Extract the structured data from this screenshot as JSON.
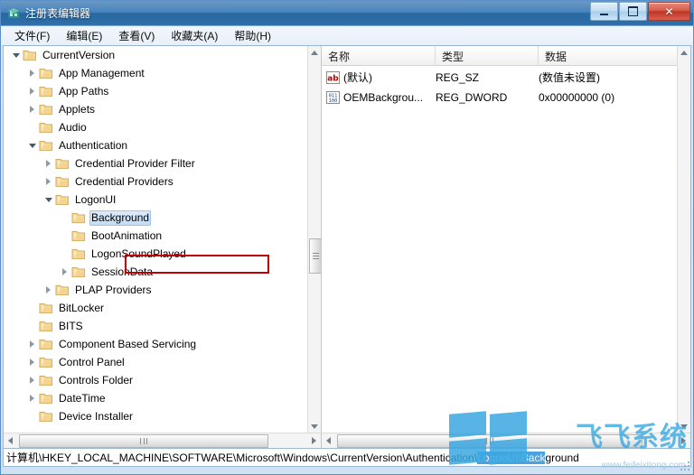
{
  "window": {
    "title": "注册表编辑器",
    "icon": "registry-editor-icon",
    "buttons": {
      "minimize": "最小化",
      "maximize": "最大化",
      "close": "✕"
    }
  },
  "menu": {
    "items": [
      {
        "label": "文件(F)",
        "name": "menu-file"
      },
      {
        "label": "编辑(E)",
        "name": "menu-edit"
      },
      {
        "label": "查看(V)",
        "name": "menu-view"
      },
      {
        "label": "收藏夹(A)",
        "name": "menu-favorites"
      },
      {
        "label": "帮助(H)",
        "name": "menu-help"
      }
    ]
  },
  "tree": {
    "nodes": [
      {
        "label": "CurrentVersion",
        "depth": 0,
        "state": "expanded",
        "selected": false
      },
      {
        "label": "App Management",
        "depth": 1,
        "state": "collapsed",
        "selected": false
      },
      {
        "label": "App Paths",
        "depth": 1,
        "state": "collapsed",
        "selected": false
      },
      {
        "label": "Applets",
        "depth": 1,
        "state": "collapsed",
        "selected": false
      },
      {
        "label": "Audio",
        "depth": 1,
        "state": "leaf",
        "selected": false
      },
      {
        "label": "Authentication",
        "depth": 1,
        "state": "expanded",
        "selected": false
      },
      {
        "label": "Credential Provider Filter",
        "depth": 2,
        "state": "collapsed",
        "selected": false
      },
      {
        "label": "Credential Providers",
        "depth": 2,
        "state": "collapsed",
        "selected": false
      },
      {
        "label": "LogonUI",
        "depth": 2,
        "state": "expanded",
        "selected": false
      },
      {
        "label": "Background",
        "depth": 3,
        "state": "leaf",
        "selected": true
      },
      {
        "label": "BootAnimation",
        "depth": 3,
        "state": "leaf",
        "selected": false
      },
      {
        "label": "LogonSoundPlayed",
        "depth": 3,
        "state": "leaf",
        "selected": false
      },
      {
        "label": "SessionData",
        "depth": 3,
        "state": "collapsed",
        "selected": false
      },
      {
        "label": "PLAP Providers",
        "depth": 2,
        "state": "collapsed",
        "selected": false
      },
      {
        "label": "BitLocker",
        "depth": 1,
        "state": "leaf",
        "selected": false
      },
      {
        "label": "BITS",
        "depth": 1,
        "state": "leaf",
        "selected": false
      },
      {
        "label": "Component Based Servicing",
        "depth": 1,
        "state": "collapsed",
        "selected": false
      },
      {
        "label": "Control Panel",
        "depth": 1,
        "state": "collapsed",
        "selected": false
      },
      {
        "label": "Controls Folder",
        "depth": 1,
        "state": "collapsed",
        "selected": false
      },
      {
        "label": "DateTime",
        "depth": 1,
        "state": "collapsed",
        "selected": false
      },
      {
        "label": "Device Installer",
        "depth": 1,
        "state": "leaf",
        "selected": false
      }
    ],
    "highlight_node": "Background",
    "highlight_color": "#c00000"
  },
  "values": {
    "columns": [
      {
        "label": "名称",
        "name": "column-name"
      },
      {
        "label": "类型",
        "name": "column-type"
      },
      {
        "label": "数据",
        "name": "column-data"
      }
    ],
    "rows": [
      {
        "icon": "string-value-icon",
        "name": "(默认)",
        "type": "REG_SZ",
        "data": "(数值未设置)"
      },
      {
        "icon": "dword-value-icon",
        "name": "OEMBackgrou...",
        "type": "REG_DWORD",
        "data": "0x00000000 (0)"
      }
    ]
  },
  "status": {
    "path_before": "计算机\\HKEY_LOCAL_MACHINE\\SOFTWARE\\Microsoft\\Windows\\CurrentVersion\\Authentication\\",
    "path_selected": "LogonUI\\Back",
    "path_after": "ground"
  },
  "watermark": {
    "brand": "飞飞系统",
    "url": "www.feifeixitong.com",
    "logo_color": "#3aa8e0"
  }
}
